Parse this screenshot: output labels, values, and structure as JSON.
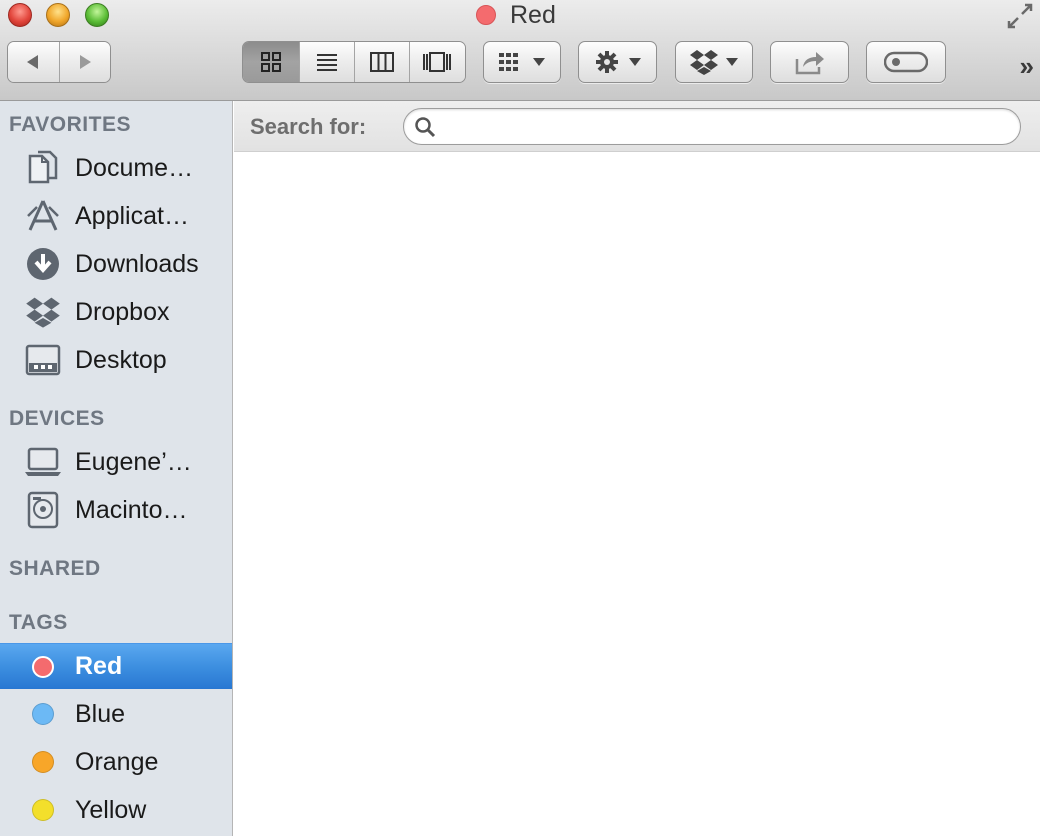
{
  "window": {
    "title": "Red",
    "title_tag_color": "#f46b6e"
  },
  "toolbar": {
    "buttons": [
      "back",
      "forward",
      "icon-view",
      "list-view",
      "column-view",
      "cover-flow-view",
      "arrange",
      "action",
      "dropbox",
      "share",
      "edit-tags"
    ],
    "overflow": "»"
  },
  "search": {
    "label": "Search for:",
    "value": "",
    "placeholder": ""
  },
  "sidebar": {
    "favorites_title": "FAVORITES",
    "favorites": [
      {
        "label": "Docume…",
        "icon": "documents-icon"
      },
      {
        "label": "Applicat…",
        "icon": "applications-icon"
      },
      {
        "label": "Downloads",
        "icon": "downloads-icon"
      },
      {
        "label": "Dropbox",
        "icon": "dropbox-icon"
      },
      {
        "label": "Desktop",
        "icon": "desktop-icon"
      }
    ],
    "devices_title": "DEVICES",
    "devices": [
      {
        "label": "Eugene’…",
        "icon": "laptop-icon"
      },
      {
        "label": "Macinto…",
        "icon": "hard-drive-icon"
      }
    ],
    "shared_title": "SHARED",
    "tags_title": "TAGS",
    "tags": [
      {
        "label": "Red",
        "color": "#f46b6e",
        "selected": true
      },
      {
        "label": "Blue",
        "color": "#6cb9f5",
        "selected": false
      },
      {
        "label": "Orange",
        "color": "#f8a629",
        "selected": false
      },
      {
        "label": "Yellow",
        "color": "#f3df2b",
        "selected": false
      }
    ]
  }
}
